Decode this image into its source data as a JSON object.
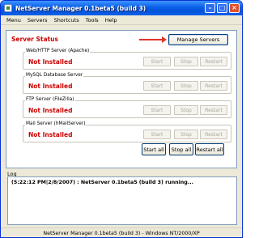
{
  "window": {
    "title": "NetServer Manager 0.1beta5 (build 3)"
  },
  "menu": [
    "Menu",
    "Servers",
    "Shortcuts",
    "Tools",
    "Help"
  ],
  "panel": {
    "heading": "Server Status",
    "manage_label": "Manage Servers",
    "servers": [
      {
        "name": "Web/HTTP Server (Apache)",
        "status": "Not Installed"
      },
      {
        "name": "MySQL Database Server",
        "status": "Not Installed"
      },
      {
        "name": "FTP Server (FileZilla)",
        "status": "Not Installed"
      },
      {
        "name": "Mail Server (hMailServer)",
        "status": "Not Installed"
      }
    ],
    "buttons": {
      "start": "Start",
      "stop": "Stop",
      "restart": "Restart"
    },
    "start_all": "Start all",
    "stop_all": "Stop all",
    "restart_all": "Restart all"
  },
  "log": {
    "label": "Log",
    "lines": [
      "(5:22:12 PM|2/8/2007) : NetServer 0.1beta5 (build 3) running..."
    ]
  },
  "statusbar": "NetServer Manager 0.1beta5 (build 3) - Windows NT/2000/XP",
  "colors": {
    "accent": "#0a5ee8",
    "not_installed": "#cc0000",
    "arrow": "#e0332b"
  }
}
